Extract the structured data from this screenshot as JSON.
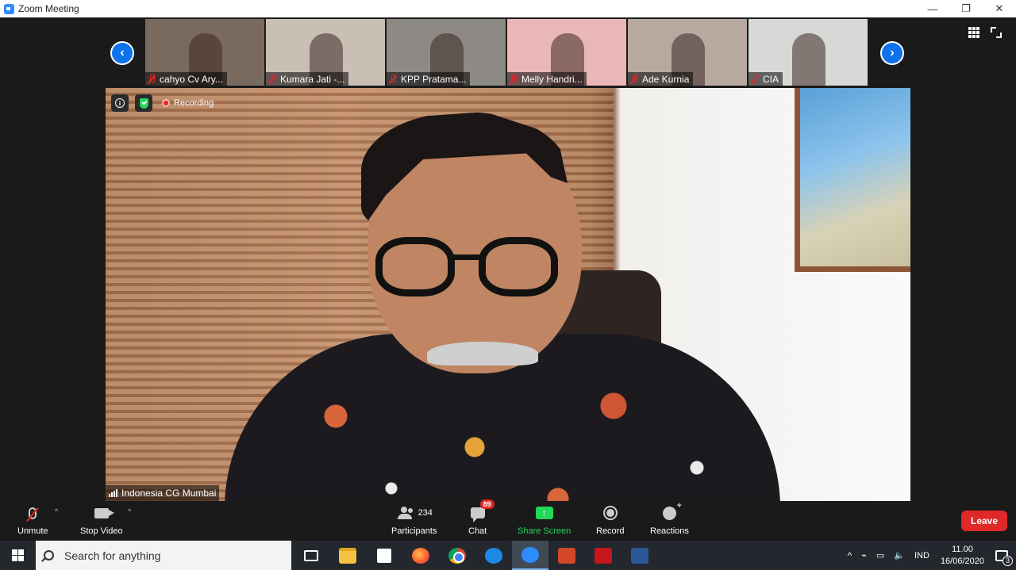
{
  "window": {
    "title": "Zoom Meeting",
    "controls": {
      "minimize": "—",
      "restore": "❐",
      "close": "✕"
    }
  },
  "gallery": {
    "participants": [
      {
        "name": "cahyo Cv Ary...",
        "bg": "#7a6a5e"
      },
      {
        "name": "Kumara Jati -...",
        "bg": "#c9bfb5"
      },
      {
        "name": "KPP Pratama...",
        "bg": "#8d8a86"
      },
      {
        "name": "Melly Handri...",
        "bg": "#e9b7b5"
      },
      {
        "name": "Ade Kurnia",
        "bg": "#b7a9a0"
      },
      {
        "name": "CIA",
        "bg": "#d8d8d6"
      }
    ],
    "prev_icon": "chevron-left-icon",
    "next_icon": "chevron-right-icon"
  },
  "main_video": {
    "status": "Recording",
    "speaker_name": "Indonesia CG Mumbai"
  },
  "toolbar": {
    "unmute": "Unmute",
    "stop_video": "Stop Video",
    "participants_label": "Participants",
    "participants_count": "234",
    "chat_label": "Chat",
    "chat_badge": "89",
    "share_screen": "Share Screen",
    "record": "Record",
    "reactions": "Reactions",
    "leave": "Leave"
  },
  "taskbar": {
    "search_placeholder": "Search for anything",
    "apps": [
      "task-view",
      "file-explorer",
      "microsoft-store",
      "firefox",
      "chrome",
      "edge",
      "zoom",
      "powerpoint",
      "acrobat",
      "word"
    ],
    "language": "IND",
    "time": "11.00",
    "date": "16/06/2020",
    "notification_count": "3"
  },
  "colors": {
    "zoom_blue": "#0e72ed",
    "leave_red": "#e02828",
    "share_green": "#23d959",
    "toolbar_bg": "#1a1a1a",
    "taskbar_bg": "#23282e"
  }
}
